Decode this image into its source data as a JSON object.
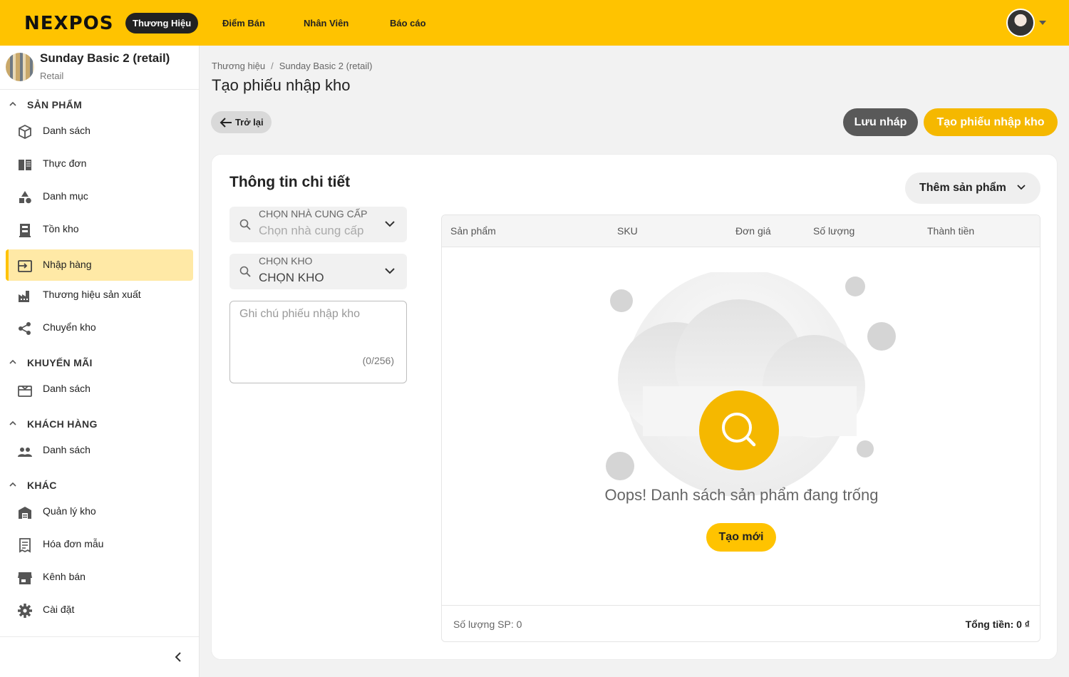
{
  "brand": {
    "logo": "NEXPOS"
  },
  "topnav": {
    "items": [
      {
        "label": "Thương Hiệu",
        "active": true
      },
      {
        "label": "Điểm Bán"
      },
      {
        "label": "Nhân Viên"
      },
      {
        "label": "Báo cáo"
      }
    ]
  },
  "store": {
    "name": "Sunday Basic 2 (retail)",
    "type": "Retail"
  },
  "sidebar": {
    "sections": [
      {
        "label": "SẢN PHẨM",
        "items": [
          "Danh sách",
          "Thực đơn",
          "Danh mục",
          "Tồn kho",
          "Nhập hàng",
          "Thương hiệu sản xuất",
          "Chuyển kho"
        ]
      },
      {
        "label": "KHUYẾN MÃI",
        "items": [
          "Danh sách"
        ]
      },
      {
        "label": "KHÁCH HÀNG",
        "items": [
          "Danh sách"
        ]
      },
      {
        "label": "KHÁC",
        "items": [
          "Quản lý kho",
          "Hóa đơn mẫu",
          "Kênh bán",
          "Cài đặt"
        ]
      }
    ],
    "active_item": "Nhập hàng"
  },
  "breadcrumb": {
    "items": [
      "Thương hiệu",
      "Sunday Basic 2 (retail)"
    ],
    "separator": "/"
  },
  "page": {
    "title": "Tạo phiếu nhập kho"
  },
  "actions": {
    "back": "Trở lại",
    "save_draft": "Lưu nháp",
    "create": "Tạo phiếu nhập kho"
  },
  "detail": {
    "title": "Thông tin chi tiết",
    "add_product": "Thêm sản phẩm",
    "supplier": {
      "label": "CHỌN NHÀ CUNG CẤP",
      "placeholder": "Chọn nhà cung cấp"
    },
    "warehouse": {
      "label": "CHỌN KHO",
      "value": "CHỌN KHO"
    },
    "note": {
      "placeholder": "Ghi chú phiếu nhập kho",
      "counter": "(0/256)"
    }
  },
  "table": {
    "columns": [
      "Sản phẩm",
      "SKU",
      "Đơn giá",
      "Số lượng",
      "Thành tiền"
    ],
    "rows": [],
    "empty_message": "Oops! Danh sách sản phẩm đang trống",
    "empty_action": "Tạo mới",
    "footer": {
      "count": "Số lượng SP: 0",
      "total": "Tổng tiền: 0 ₫"
    }
  },
  "colors": {
    "brand_yellow": "#ffc300",
    "create_button": "#f5b800",
    "draft_button": "#595959",
    "active_bg": "#ffe9a6"
  }
}
